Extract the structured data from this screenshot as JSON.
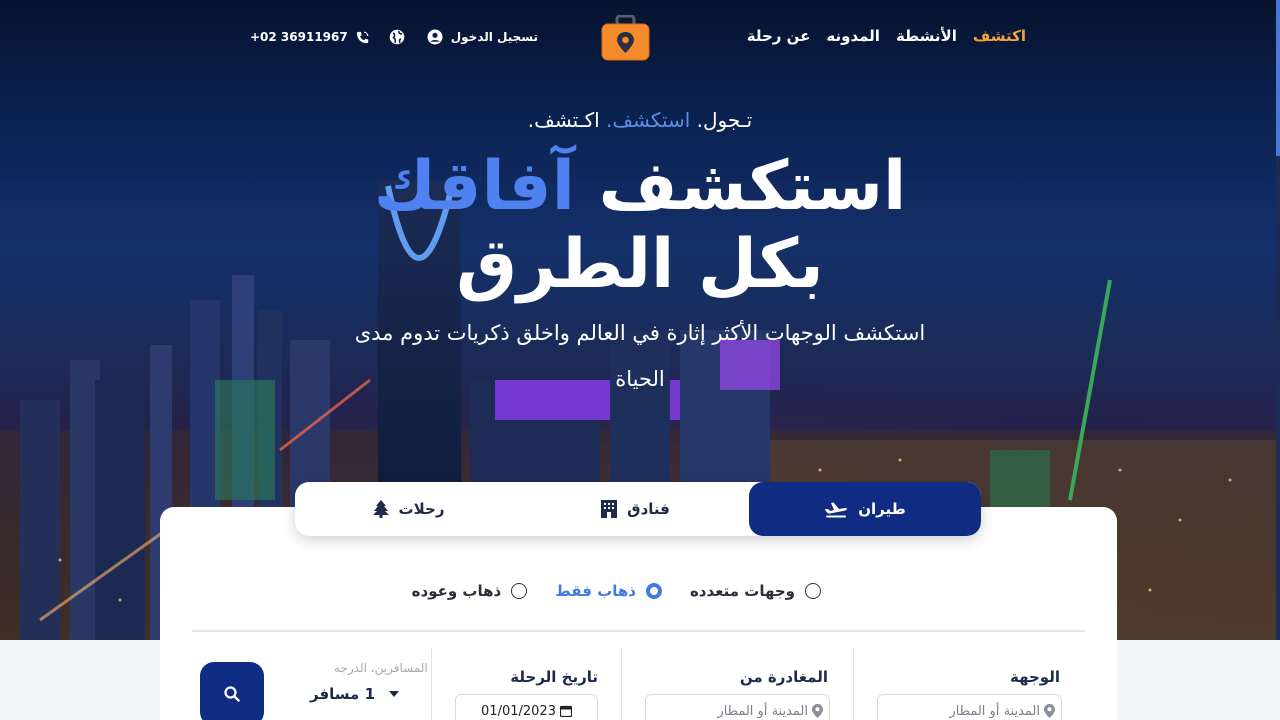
{
  "nav": {
    "links": [
      "اكتشف",
      "الأنشطة",
      "المدونه",
      "عن رحلة"
    ],
    "phone": "+02 36911967",
    "login": "تسجيل الدخول",
    "active_color": "#f7a23b"
  },
  "hero": {
    "tagline_1": "تـجول.",
    "tagline_2": "استكشف.",
    "tagline_3": "اكـتشف.",
    "headline_1": "استكشف",
    "headline_2": "آفاقك",
    "headline_3": "بكل الطرق",
    "subline": "استكشف الوجهات الأكثر إثارة في العالم واخلق ذكريات تدوم مدى الحياة"
  },
  "tabs": [
    {
      "label": "طيران",
      "icon": "plane-icon",
      "active": true
    },
    {
      "label": "فنادق",
      "icon": "hotel-icon",
      "active": false
    },
    {
      "label": "رحلات",
      "icon": "tree-icon",
      "active": false
    }
  ],
  "trip_types": [
    {
      "label": "ذهاب وعوده",
      "selected": false
    },
    {
      "label": "ذهاب فقط",
      "selected": true
    },
    {
      "label": "وجهات متعدده",
      "selected": false
    }
  ],
  "form": {
    "destination_title": "الوجهة",
    "destination_placeholder": "المدينة أو المطار",
    "departure_title": "المغادرة من",
    "departure_placeholder": "المدينة أو المطار",
    "date_title": "تاريخ الرحلة",
    "date_value": "01/01/2023",
    "passengers_label": "المسافرين، الدرجه",
    "passengers_value": "1 مسافر"
  },
  "colors": {
    "primary": "#0f2c82",
    "accent_blue": "#4f82f0",
    "accent_orange": "#f7a23b"
  }
}
